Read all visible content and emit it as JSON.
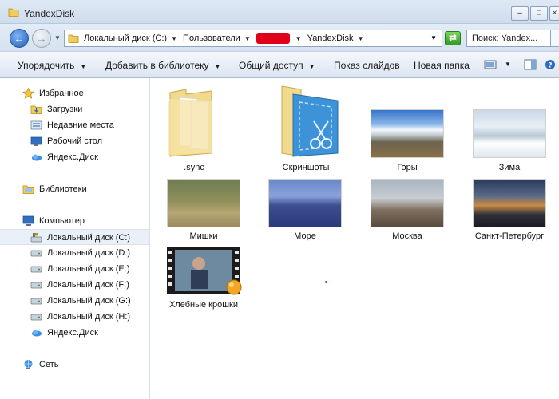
{
  "window": {
    "title": "YandexDisk",
    "minimize_glyph": "–",
    "maximize_glyph": "□",
    "close_glyph": "×"
  },
  "address_bar": {
    "crumbs": [
      "Локальный диск (C:)",
      "Пользователи",
      "YandexDisk"
    ],
    "search_placeholder": "Поиск: Yandex..."
  },
  "toolbar": {
    "organize": "Упорядочить",
    "add_to_library": "Добавить в библиотеку",
    "share": "Общий доступ",
    "slideshow": "Показ слайдов",
    "new_folder": "Новая папка"
  },
  "sidebar": {
    "favorites": {
      "header": "Избранное",
      "items": [
        "Загрузки",
        "Недавние места",
        "Рабочий стол",
        "Яндекс.Диск"
      ]
    },
    "libraries": "Библиотеки",
    "computer": {
      "header": "Компьютер",
      "items": [
        "Локальный диск (C:)",
        "Локальный диск (D:)",
        "Локальный диск (E:)",
        "Локальный диск (F:)",
        "Локальный диск (G:)",
        "Локальный диск (H:)",
        "Яндекс.Диск"
      ]
    },
    "network": "Сеть"
  },
  "content": {
    "items": [
      {
        "name": ".sync",
        "kind": "folder"
      },
      {
        "name": "Скриншоты",
        "kind": "folder"
      },
      {
        "name": "Горы",
        "kind": "image"
      },
      {
        "name": "Зима",
        "kind": "image"
      },
      {
        "name": "Мишки",
        "kind": "image"
      },
      {
        "name": "Море",
        "kind": "image"
      },
      {
        "name": "Москва",
        "kind": "image"
      },
      {
        "name": "Санкт-Петербург",
        "kind": "image"
      },
      {
        "name": "Хлебные крошки",
        "kind": "video"
      }
    ]
  },
  "colors": {
    "accent": "#1f5fb8",
    "selection": "#eaf0f7",
    "redaction": "#e0001a"
  }
}
